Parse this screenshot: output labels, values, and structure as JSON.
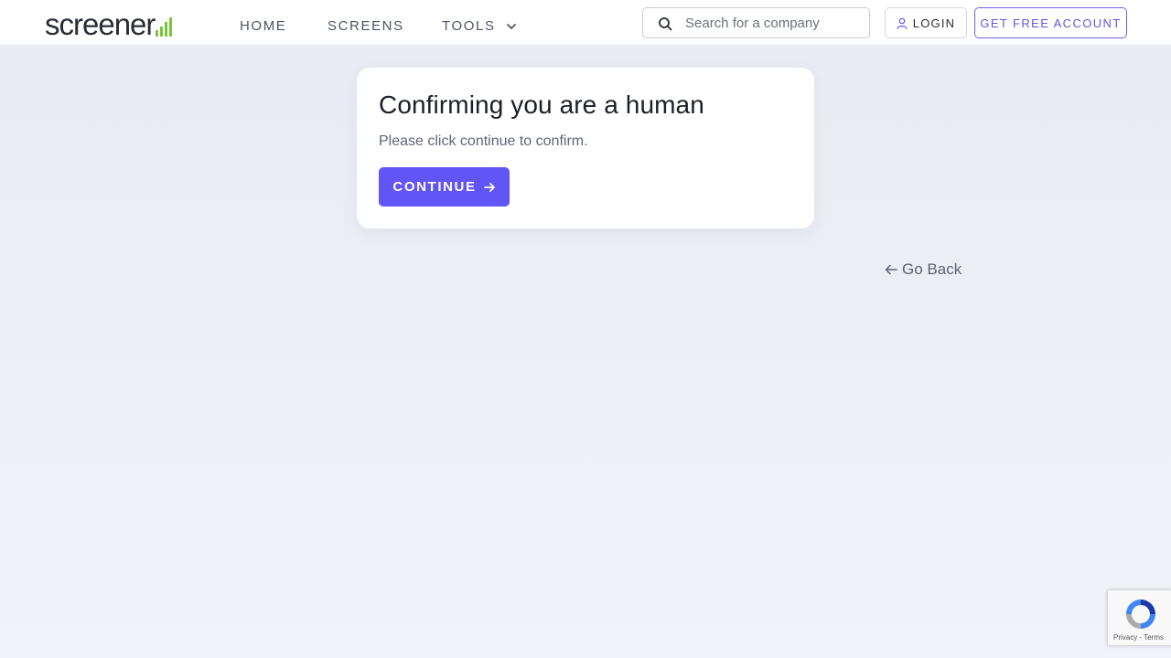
{
  "brand": {
    "logo_text": "screener",
    "accent_color": "#7cc442"
  },
  "nav": {
    "home": "HOME",
    "screens": "SCREENS",
    "tools": "TOOLS"
  },
  "search": {
    "placeholder": "Search for a company"
  },
  "header_buttons": {
    "login": "LOGIN",
    "free_account": "GET FREE ACCOUNT"
  },
  "card": {
    "title": "Confirming you are a human",
    "subtitle": "Please click continue to confirm.",
    "continue_label": "CONTINUE"
  },
  "go_back": {
    "label": "Go Back"
  },
  "recaptcha": {
    "privacy": "Privacy",
    "separator": " - ",
    "terms": "Terms"
  },
  "colors": {
    "primary": "#6155f5",
    "background": "#e8ebf3",
    "card": "#ffffff"
  },
  "icons": {
    "search": "search-icon",
    "user": "user-icon",
    "chevron": "chevron-down-icon",
    "arrow_right": "arrow-right-icon",
    "arrow_left": "arrow-left-icon",
    "recaptcha": "recaptcha-logo-icon"
  }
}
